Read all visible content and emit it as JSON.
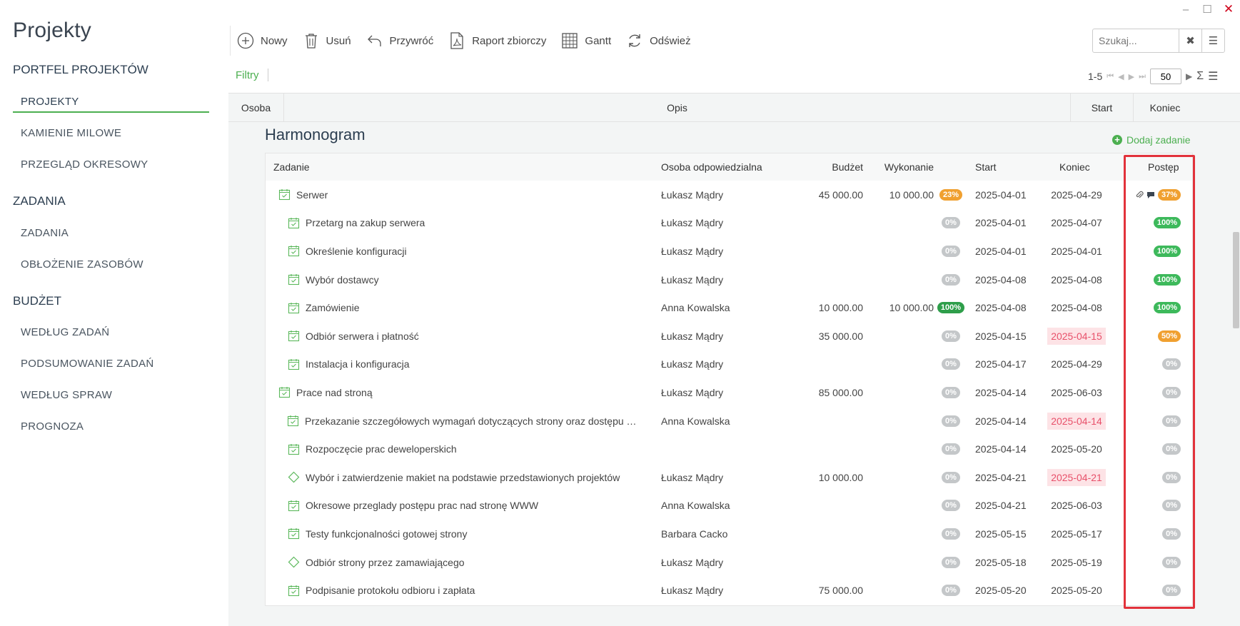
{
  "app": {
    "title": "Projekty"
  },
  "sidebar": {
    "sections": [
      {
        "label": "PORTFEL PROJEKTÓW",
        "items": [
          {
            "label": "PROJEKTY",
            "active": true
          },
          {
            "label": "KAMIENIE MILOWE"
          },
          {
            "label": "PRZEGLĄD OKRESOWY"
          }
        ]
      },
      {
        "label": "ZADANIA",
        "items": [
          {
            "label": "ZADANIA"
          },
          {
            "label": "OBŁOŻENIE ZASOBÓW"
          }
        ]
      },
      {
        "label": "BUDŻET",
        "items": [
          {
            "label": "WEDŁUG ZADAŃ"
          },
          {
            "label": "PODSUMOWANIE ZADAŃ"
          },
          {
            "label": "WEDŁUG SPRAW"
          },
          {
            "label": "PROGNOZA"
          }
        ]
      }
    ]
  },
  "toolbar": {
    "new": "Nowy",
    "delete": "Usuń",
    "restore": "Przywróć",
    "report": "Raport zbiorczy",
    "gantt": "Gantt",
    "refresh": "Odśwież"
  },
  "search": {
    "placeholder": "Szukaj..."
  },
  "filters": {
    "label": "Filtry"
  },
  "pager": {
    "range": "1-5",
    "page_size": "50"
  },
  "outer_columns": {
    "person": "Osoba",
    "description": "Opis",
    "start": "Start",
    "end": "Koniec"
  },
  "harmonogram": {
    "title": "Harmonogram",
    "add_task": "Dodaj zadanie",
    "columns": {
      "task": "Zadanie",
      "responsible": "Osoba odpowiedzialna",
      "budget": "Budżet",
      "execution": "Wykonanie",
      "start": "Start",
      "end": "Koniec",
      "progress": "Postęp"
    },
    "rows": [
      {
        "name": "Serwer",
        "level": 0,
        "icon": "calendar-check",
        "person": "Łukasz Mądry",
        "budget": "45 000.00",
        "execution": "10 000.00",
        "exec_pct": "23%",
        "exec_color": "orange",
        "start": "2025-04-01",
        "end": "2025-04-29",
        "end_overdue": false,
        "progress": "37%",
        "progress_color": "orange",
        "attachment": true,
        "comment": true
      },
      {
        "name": "Przetarg na zakup serwera",
        "level": 1,
        "icon": "calendar-check",
        "person": "Łukasz Mądry",
        "budget": "",
        "execution": "",
        "exec_pct": "0%",
        "exec_color": "gray",
        "start": "2025-04-01",
        "end": "2025-04-07",
        "end_overdue": false,
        "progress": "100%",
        "progress_color": "green"
      },
      {
        "name": "Określenie konfiguracji",
        "level": 1,
        "icon": "calendar-check",
        "person": "Łukasz Mądry",
        "budget": "",
        "execution": "",
        "exec_pct": "0%",
        "exec_color": "gray",
        "start": "2025-04-01",
        "end": "2025-04-01",
        "end_overdue": false,
        "progress": "100%",
        "progress_color": "green"
      },
      {
        "name": "Wybór dostawcy",
        "level": 1,
        "icon": "calendar-check",
        "person": "Łukasz Mądry",
        "budget": "",
        "execution": "",
        "exec_pct": "0%",
        "exec_color": "gray",
        "start": "2025-04-08",
        "end": "2025-04-08",
        "end_overdue": false,
        "progress": "100%",
        "progress_color": "green"
      },
      {
        "name": "Zamówienie",
        "level": 1,
        "icon": "calendar-check",
        "person": "Anna Kowalska",
        "budget": "10 000.00",
        "execution": "10 000.00",
        "exec_pct": "100%",
        "exec_color": "dkgreen",
        "start": "2025-04-08",
        "end": "2025-04-08",
        "end_overdue": false,
        "progress": "100%",
        "progress_color": "green"
      },
      {
        "name": "Odbiór serwera i płatność",
        "level": 1,
        "icon": "calendar-check",
        "person": "Łukasz Mądry",
        "budget": "35 000.00",
        "execution": "",
        "exec_pct": "0%",
        "exec_color": "gray",
        "start": "2025-04-15",
        "end": "2025-04-15",
        "end_overdue": true,
        "progress": "50%",
        "progress_color": "orange"
      },
      {
        "name": "Instalacja i konfiguracja",
        "level": 1,
        "icon": "calendar-check",
        "person": "Łukasz Mądry",
        "budget": "",
        "execution": "",
        "exec_pct": "0%",
        "exec_color": "gray",
        "start": "2025-04-17",
        "end": "2025-04-29",
        "end_overdue": false,
        "progress": "0%",
        "progress_color": "gray"
      },
      {
        "name": "Prace nad stroną",
        "level": 0,
        "icon": "calendar-check",
        "person": "Łukasz Mądry",
        "budget": "85 000.00",
        "execution": "",
        "exec_pct": "0%",
        "exec_color": "gray",
        "start": "2025-04-14",
        "end": "2025-06-03",
        "end_overdue": false,
        "progress": "0%",
        "progress_color": "gray"
      },
      {
        "name": "Przekazanie szczegółowych wymagań dotyczących strony oraz dostępu …",
        "level": 1,
        "icon": "calendar-check",
        "person": "Anna Kowalska",
        "budget": "",
        "execution": "",
        "exec_pct": "0%",
        "exec_color": "gray",
        "start": "2025-04-14",
        "end": "2025-04-14",
        "end_overdue": true,
        "progress": "0%",
        "progress_color": "gray"
      },
      {
        "name": "Rozpoczęcie prac deweloperskich",
        "level": 1,
        "icon": "calendar-check",
        "person": "",
        "budget": "",
        "execution": "",
        "exec_pct": "0%",
        "exec_color": "gray",
        "start": "2025-04-14",
        "end": "2025-05-20",
        "end_overdue": false,
        "progress": "0%",
        "progress_color": "gray"
      },
      {
        "name": "Wybór i zatwierdzenie makiet na podstawie przedstawionych projektów",
        "level": 1,
        "icon": "milestone-diamond",
        "person": "Łukasz Mądry",
        "budget": "10 000.00",
        "execution": "",
        "exec_pct": "0%",
        "exec_color": "gray",
        "start": "2025-04-21",
        "end": "2025-04-21",
        "end_overdue": true,
        "progress": "0%",
        "progress_color": "gray"
      },
      {
        "name": "Okresowe przeglady postępu prac nad stronę WWW",
        "level": 1,
        "icon": "calendar-check",
        "person": "Anna Kowalska",
        "budget": "",
        "execution": "",
        "exec_pct": "0%",
        "exec_color": "gray",
        "start": "2025-04-21",
        "end": "2025-06-03",
        "end_overdue": false,
        "progress": "0%",
        "progress_color": "gray"
      },
      {
        "name": "Testy funkcjonalności gotowej strony",
        "level": 1,
        "icon": "calendar-check",
        "person": "Barbara Cacko",
        "budget": "",
        "execution": "",
        "exec_pct": "0%",
        "exec_color": "gray",
        "start": "2025-05-15",
        "end": "2025-05-17",
        "end_overdue": false,
        "progress": "0%",
        "progress_color": "gray"
      },
      {
        "name": "Odbiór strony przez zamawiającego",
        "level": 1,
        "icon": "milestone-diamond",
        "person": "Łukasz Mądry",
        "budget": "",
        "execution": "",
        "exec_pct": "0%",
        "exec_color": "gray",
        "start": "2025-05-18",
        "end": "2025-05-19",
        "end_overdue": false,
        "progress": "0%",
        "progress_color": "gray"
      },
      {
        "name": "Podpisanie protokołu odbioru i zapłata",
        "level": 1,
        "icon": "calendar-check",
        "person": "Łukasz Mądry",
        "budget": "75 000.00",
        "execution": "",
        "exec_pct": "0%",
        "exec_color": "gray",
        "start": "2025-05-20",
        "end": "2025-05-20",
        "end_overdue": false,
        "progress": "0%",
        "progress_color": "gray"
      }
    ]
  },
  "colors": {
    "accent": "#4caf50",
    "highlight": "#e2323b",
    "overdue_bg": "#fde3e6",
    "overdue_text": "#e8506a"
  }
}
